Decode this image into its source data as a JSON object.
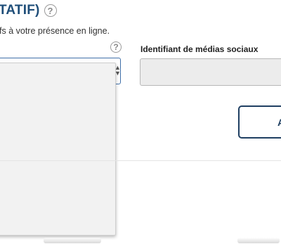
{
  "section": {
    "title": "TATIF)",
    "help_icon": "question-circle-icon",
    "subtitle": "fs à votre présence en ligne."
  },
  "social_media": {
    "label": "Identifiant de médias sociaux",
    "value": ""
  },
  "platform_select": {
    "help_icon": "question-circle-icon",
    "arrows_icon": "select-updown-icon",
    "dropdown_open": true
  },
  "add_button": {
    "label": "A"
  },
  "colors": {
    "title": "#1f4e79",
    "select_border": "#3f6fa8",
    "button_border": "#1f3f62",
    "input_bg": "#ececec",
    "dropdown_bg": "#f2f2f2"
  }
}
